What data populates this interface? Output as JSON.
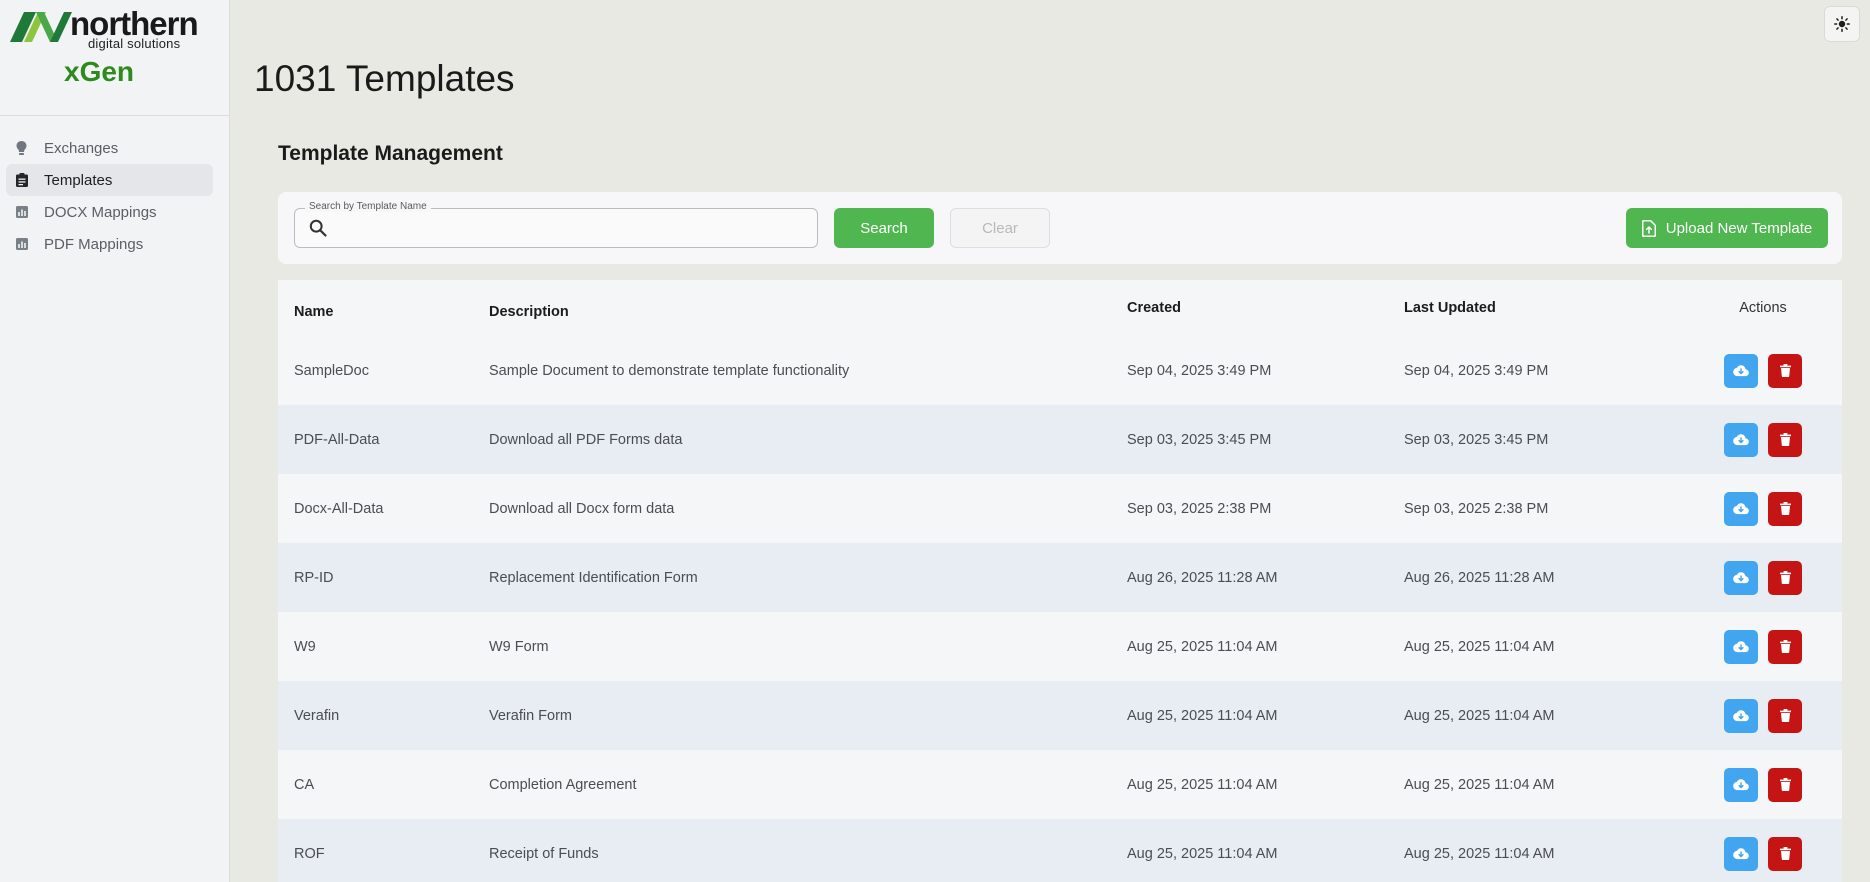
{
  "brand": {
    "company": "northern",
    "company_sub": "digital solutions",
    "app_name": "xGen",
    "colors": {
      "green": "#2f8a1e",
      "logo_dark_green": "#1f7a3a",
      "logo_light_green": "#8cc63f"
    }
  },
  "sidebar": {
    "items": [
      {
        "label": "Exchanges",
        "icon": "lightbulb-icon",
        "active": false
      },
      {
        "label": "Templates",
        "icon": "clipboard-icon",
        "active": true
      },
      {
        "label": "DOCX Mappings",
        "icon": "bar-chart-icon",
        "active": false
      },
      {
        "label": "PDF Mappings",
        "icon": "bar-chart-icon",
        "active": false
      }
    ]
  },
  "header": {
    "title": "1031 Templates",
    "theme_toggle_icon": "sun-icon"
  },
  "section": {
    "title": "Template Management"
  },
  "toolbar": {
    "search_label": "Search by Template Name",
    "search_value": "",
    "search_button": "Search",
    "clear_button": "Clear",
    "upload_button": "Upload New Template",
    "accent": "#4fb650"
  },
  "table": {
    "columns": {
      "name": "Name",
      "description": "Description",
      "created": "Created",
      "updated": "Last Updated",
      "actions": "Actions"
    },
    "rows": [
      {
        "name": "SampleDoc",
        "description": "Sample Document to demonstrate template functionality",
        "created": "Sep 04, 2025 3:49 PM",
        "updated": "Sep 04, 2025 3:49 PM"
      },
      {
        "name": "PDF-All-Data",
        "description": "Download all PDF Forms data",
        "created": "Sep 03, 2025 3:45 PM",
        "updated": "Sep 03, 2025 3:45 PM"
      },
      {
        "name": "Docx-All-Data",
        "description": "Download all Docx form data",
        "created": "Sep 03, 2025 2:38 PM",
        "updated": "Sep 03, 2025 2:38 PM"
      },
      {
        "name": "RP-ID",
        "description": "Replacement Identification Form",
        "created": "Aug 26, 2025 11:28 AM",
        "updated": "Aug 26, 2025 11:28 AM"
      },
      {
        "name": "W9",
        "description": "W9 Form",
        "created": "Aug 25, 2025 11:04 AM",
        "updated": "Aug 25, 2025 11:04 AM"
      },
      {
        "name": "Verafin",
        "description": "Verafin Form",
        "created": "Aug 25, 2025 11:04 AM",
        "updated": "Aug 25, 2025 11:04 AM"
      },
      {
        "name": "CA",
        "description": "Completion Agreement",
        "created": "Aug 25, 2025 11:04 AM",
        "updated": "Aug 25, 2025 11:04 AM"
      },
      {
        "name": "ROF",
        "description": "Receipt of Funds",
        "created": "Aug 25, 2025 11:04 AM",
        "updated": "Aug 25, 2025 11:04 AM"
      }
    ],
    "action_icons": {
      "download": "cloud-download-icon",
      "delete": "trash-icon"
    },
    "action_colors": {
      "download": "#41a5ef",
      "delete": "#c41414"
    }
  }
}
